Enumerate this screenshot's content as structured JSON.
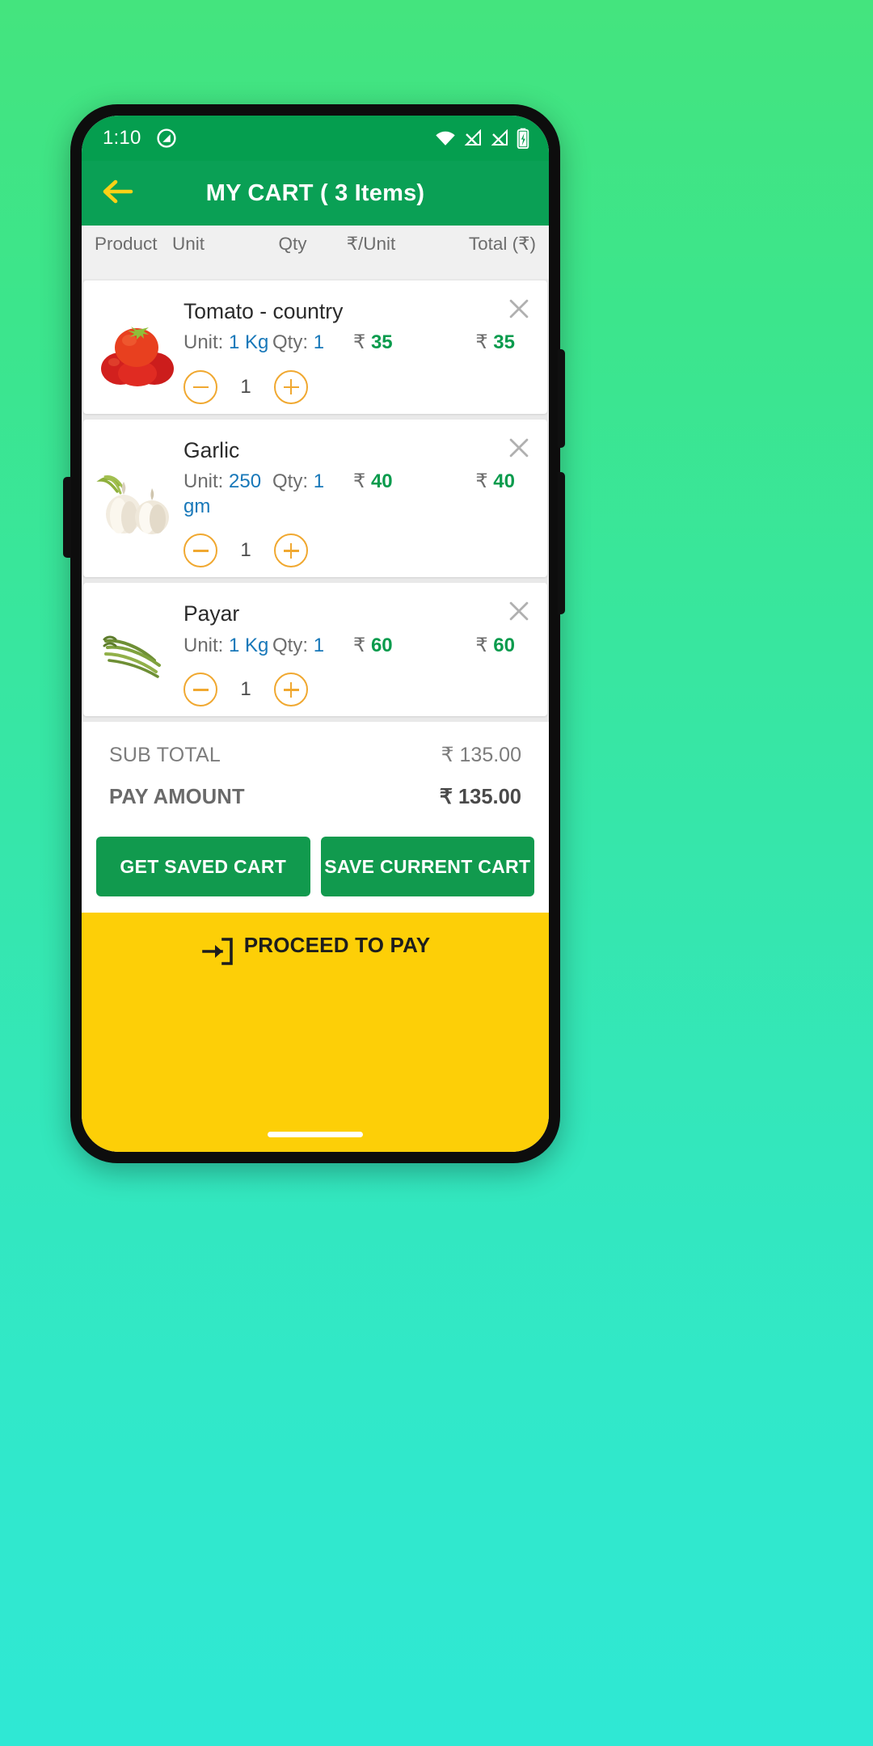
{
  "status_bar": {
    "time": "1:10",
    "icons": [
      "do-not-disturb-icon",
      "wifi-icon",
      "signal-icon-1",
      "signal-icon-2",
      "battery-icon"
    ]
  },
  "app_bar": {
    "back_icon": "arrow-left-icon",
    "title": "MY CART ( 3 Items)",
    "bg_color": "#0aa055",
    "back_icon_color": "#fcd116"
  },
  "table_header": {
    "product": "Product",
    "unit": "Unit",
    "qty": "Qty",
    "rate": "₹/Unit",
    "total": "Total (₹)"
  },
  "cart_items": [
    {
      "name": "Tomato - country",
      "image": "tomato-image",
      "unit_label": "Unit:",
      "unit_value": "1 Kg",
      "qty_label": "Qty:",
      "qty_value": "1",
      "rate_symbol": "₹",
      "rate_value": "35",
      "total_symbol": "₹",
      "total_value": "35",
      "stepper_qty": "1",
      "remove_icon": "close-icon"
    },
    {
      "name": "Garlic",
      "image": "garlic-image",
      "unit_label": "Unit:",
      "unit_value": "250 gm",
      "qty_label": "Qty:",
      "qty_value": "1",
      "rate_symbol": "₹",
      "rate_value": "40",
      "total_symbol": "₹",
      "total_value": "40",
      "stepper_qty": "1",
      "remove_icon": "close-icon"
    },
    {
      "name": "Payar",
      "image": "payar-image",
      "unit_label": "Unit:",
      "unit_value": "1 Kg",
      "qty_label": "Qty:",
      "qty_value": "1",
      "rate_symbol": "₹",
      "rate_value": "60",
      "total_symbol": "₹",
      "total_value": "60",
      "stepper_qty": "1",
      "remove_icon": "close-icon"
    }
  ],
  "totals": {
    "sub_total_label": "SUB TOTAL",
    "sub_total_value": "₹ 135.00",
    "pay_amount_label": "PAY AMOUNT",
    "pay_amount_value": "₹ 135.00"
  },
  "actions": {
    "get_saved_cart": "GET SAVED CART",
    "save_current_cart": "SAVE CURRENT CART",
    "button_color": "#119a4e"
  },
  "proceed": {
    "label": "PROCEED TO PAY",
    "icon": "login-arrow-icon",
    "bg_color": "#fdcf07"
  }
}
